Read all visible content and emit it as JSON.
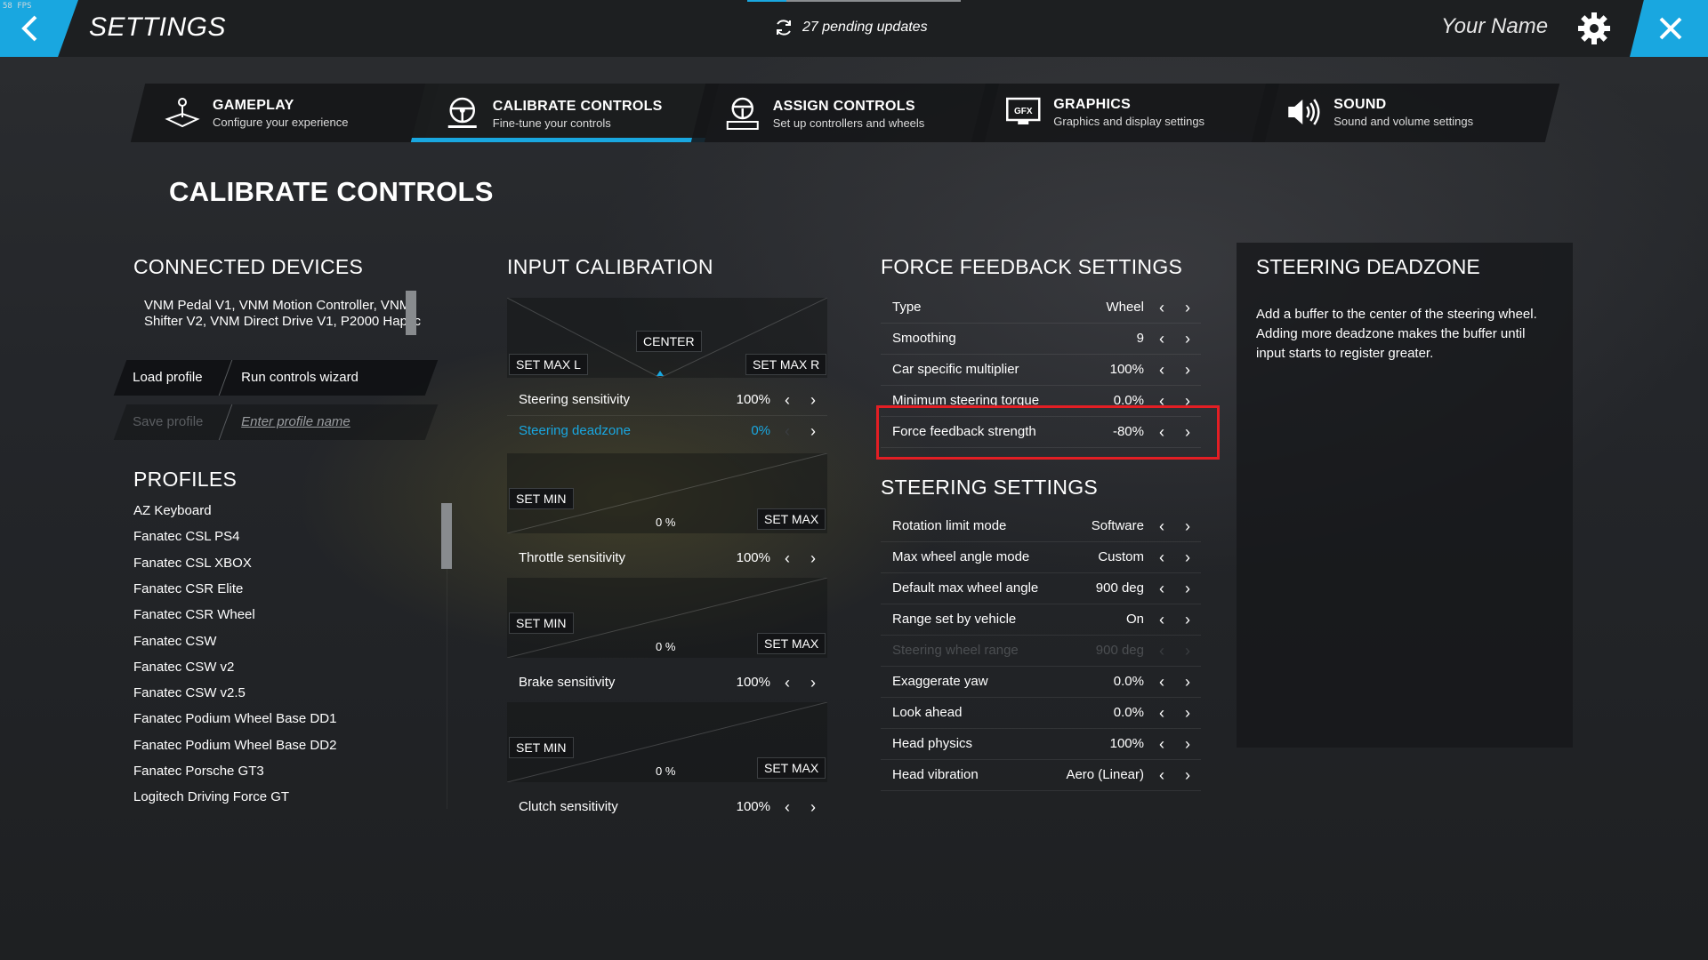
{
  "topbar": {
    "fps": "58 FPS",
    "title": "SETTINGS",
    "pending": "27 pending updates",
    "username": "Your Name"
  },
  "tabs": [
    {
      "title": "GAMEPLAY",
      "subtitle": "Configure your experience",
      "icon": "joystick-icon",
      "active": false
    },
    {
      "title": "CALIBRATE CONTROLS",
      "subtitle": "Fine-tune your controls",
      "icon": "steering-wheel-icon",
      "active": true
    },
    {
      "title": "ASSIGN CONTROLS",
      "subtitle": "Set up controllers and wheels",
      "icon": "wheel-keyboard-icon",
      "active": false
    },
    {
      "title": "GRAPHICS",
      "subtitle": "Graphics and display settings",
      "icon": "gfx-monitor-icon",
      "active": false
    },
    {
      "title": "SOUND",
      "subtitle": "Sound and volume settings",
      "icon": "speaker-icon",
      "active": false
    }
  ],
  "page_title": "CALIBRATE CONTROLS",
  "connected_devices": {
    "title": "CONNECTED DEVICES",
    "list": "VNM Pedal V1, VNM Motion Controller, VNM Shifter V2, VNM Direct Drive V1, P2000 Haptic",
    "load_profile": "Load profile",
    "run_wizard": "Run controls wizard",
    "save_profile": "Save profile",
    "profile_name_placeholder": "Enter profile name"
  },
  "profiles": {
    "title": "PROFILES",
    "items": [
      "AZ Keyboard",
      "Fanatec CSL PS4",
      "Fanatec CSL XBOX",
      "Fanatec CSR Elite",
      "Fanatec CSR Wheel",
      "Fanatec CSW",
      "Fanatec CSW v2",
      "Fanatec CSW v2.5",
      "Fanatec Podium Wheel Base DD1",
      "Fanatec Podium Wheel Base DD2",
      "Fanatec Porsche GT3",
      "Logitech Driving Force GT"
    ]
  },
  "input_calibration": {
    "title": "INPUT CALIBRATION",
    "steering": {
      "set_max_l": "SET MAX L",
      "center": "CENTER",
      "set_max_r": "SET MAX R",
      "sensitivity_label": "Steering sensitivity",
      "sensitivity_value": "100%",
      "deadzone_label": "Steering deadzone",
      "deadzone_value": "0%"
    },
    "throttle": {
      "set_min": "SET MIN",
      "set_max": "SET MAX",
      "percent": "0 %",
      "label": "Throttle sensitivity",
      "value": "100%"
    },
    "brake": {
      "set_min": "SET MIN",
      "set_max": "SET MAX",
      "percent": "0 %",
      "label": "Brake sensitivity",
      "value": "100%"
    },
    "clutch": {
      "set_min": "SET MIN",
      "set_max": "SET MAX",
      "percent": "0 %",
      "label": "Clutch sensitivity",
      "value": "100%"
    }
  },
  "force_feedback": {
    "title": "FORCE FEEDBACK SETTINGS",
    "rows": [
      {
        "label": "Type",
        "value": "Wheel",
        "dim": false
      },
      {
        "label": "Smoothing",
        "value": "9",
        "dim": false
      },
      {
        "label": "Car specific multiplier",
        "value": "100%",
        "dim": false
      },
      {
        "label": "Minimum steering torque",
        "value": "0.0%",
        "dim": false
      },
      {
        "label": "Force feedback strength",
        "value": "-80%",
        "dim": false
      }
    ]
  },
  "steering_settings": {
    "title": "STEERING SETTINGS",
    "rows": [
      {
        "label": "Rotation limit mode",
        "value": "Software",
        "dim": false
      },
      {
        "label": "Max wheel angle mode",
        "value": "Custom",
        "dim": false
      },
      {
        "label": "Default max wheel angle",
        "value": "900 deg",
        "dim": false
      },
      {
        "label": "Range set by vehicle",
        "value": "On",
        "dim": false
      },
      {
        "label": "Steering wheel range",
        "value": "900 deg",
        "dim": true
      },
      {
        "label": "Exaggerate yaw",
        "value": "0.0%",
        "dim": false
      },
      {
        "label": "Look ahead",
        "value": "0.0%",
        "dim": false
      },
      {
        "label": "Head physics",
        "value": "100%",
        "dim": false
      },
      {
        "label": "Head vibration",
        "value": "Aero (Linear)",
        "dim": false
      }
    ]
  },
  "info_panel": {
    "title": "STEERING DEADZONE",
    "body": "Add a buffer to the center of the steering wheel. Adding more deadzone makes the buffer until input starts to register greater."
  },
  "colors": {
    "accent": "#19a7e0",
    "highlight": "#e31e24",
    "link": "#19a7e0"
  }
}
